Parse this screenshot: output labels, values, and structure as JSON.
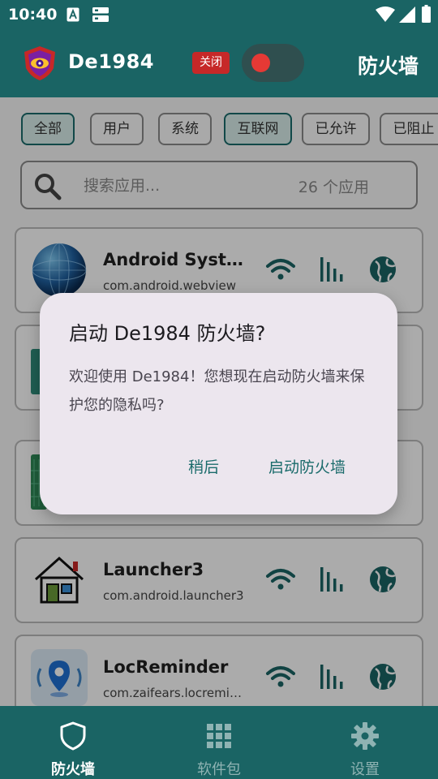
{
  "status_bar": {
    "time": "10:40"
  },
  "app_bar": {
    "title": "De1984",
    "status_badge": "关闭",
    "section_title": "防火墙",
    "colors": {
      "bar": "#1a6464",
      "badge": "#c62828",
      "knob": "#e53935"
    }
  },
  "filters": [
    {
      "label": "全部",
      "active": true
    },
    {
      "label": "用户",
      "active": false
    },
    {
      "label": "系统",
      "active": false
    },
    {
      "label": "互联网",
      "active": true
    },
    {
      "label": "已允许",
      "active": false
    },
    {
      "label": "已阻止",
      "active": false
    }
  ],
  "search": {
    "placeholder": "搜索应用...",
    "count_label": "26 个应用"
  },
  "apps": [
    {
      "name": "Android System WebView",
      "package": "com.android.webview",
      "icon": "globe-sphere-icon"
    },
    {
      "name": "",
      "package": "",
      "icon": "app-icon"
    },
    {
      "name": "",
      "package": "",
      "icon": "app-icon"
    },
    {
      "name": "Launcher3",
      "package": "com.android.launcher3",
      "icon": "house-icon"
    },
    {
      "name": "LocReminder",
      "package": "com.zaifears.locreminder",
      "icon": "location-pin-icon"
    }
  ],
  "dialog": {
    "title": "启动 De1984 防火墙?",
    "message": "欢迎使用 De1984！您想现在启动防火墙来保护您的隐私吗?",
    "cancel_label": "稍后",
    "confirm_label": "启动防火墙"
  },
  "bottom_nav": [
    {
      "label": "防火墙",
      "icon": "shield-icon",
      "active": true
    },
    {
      "label": "软件包",
      "icon": "grid-icon",
      "active": false
    },
    {
      "label": "设置",
      "icon": "gear-icon",
      "active": false
    }
  ]
}
